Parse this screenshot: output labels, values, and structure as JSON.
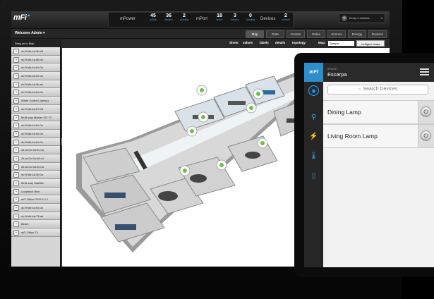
{
  "app": {
    "logo": "mFi"
  },
  "header": {
    "groups": [
      {
        "name": "mPower",
        "stats": [
          {
            "value": "45",
            "label": "active"
          },
          {
            "value": "36",
            "label": "inactive"
          },
          {
            "value": "2",
            "label": "pending"
          }
        ]
      },
      {
        "name": "mPort",
        "stats": [
          {
            "value": "18",
            "label": "active"
          },
          {
            "value": "3",
            "label": "inactive"
          },
          {
            "value": "0",
            "label": "pending"
          }
        ]
      },
      {
        "name": "Devices",
        "stats": [
          {
            "value": "2",
            "label": "connect"
          }
        ]
      }
    ],
    "refresh_interval": "Every 2 minutes"
  },
  "subbar": {
    "welcome": "Welcome Admin",
    "tabs": [
      "Map",
      "Data",
      "Events",
      "Rules",
      "Scenes",
      "Energy",
      "Devices"
    ],
    "active_tab": "Map"
  },
  "showbar": {
    "show_label": "Show:",
    "options": [
      "values",
      "labels",
      "details",
      "topology"
    ],
    "map_label": "Map:",
    "map_value": "Sample",
    "configure_label": "configure maps"
  },
  "sidebar": {
    "title": "Drag on to Map",
    "devices": [
      "dc:9f:db:4a:3b:b8",
      "dc:9f:db:4a:8b:d4",
      "dc:9f:db:4a:9c:0a",
      "dc:9f:db:4a:9c:0a",
      "dc:9f:db:4a:9b:ae",
      "dc:9f:db:4a:9c:0a",
      "White Outlet 6 (setup)",
      "dc:9f:db:4a:07:b8",
      "Multi-way Master CR 73",
      "dc:9f:db:4a:9c:0a",
      "dc:9f:db:4a:9c:0a",
      "dc:9f:db:4a:9c:0a",
      "24:a4:3c:0a:9c:0a",
      "24:a4:3c:0a:48:c4",
      "24:a4:3c:0a:9c:0a",
      "dc:9f:db:4a:2b:0a",
      "Multi-way Satellite",
      "Loopback Blue",
      "mFi Office PRO EU 2",
      "dc:9f:db:4a:9c:0a",
      "dc:9f:db:4a:73:ad",
      "Beam",
      "mFi Office TV"
    ]
  },
  "tablet": {
    "space_label": "SPACE",
    "space_name": "Escarpa",
    "search_placeholder": "Search Devices",
    "devices": [
      "Dining Lamp",
      "Living Room Lamp"
    ]
  },
  "colors": {
    "accent": "#2e8ec9",
    "stat_label": "#3ea7e8"
  }
}
